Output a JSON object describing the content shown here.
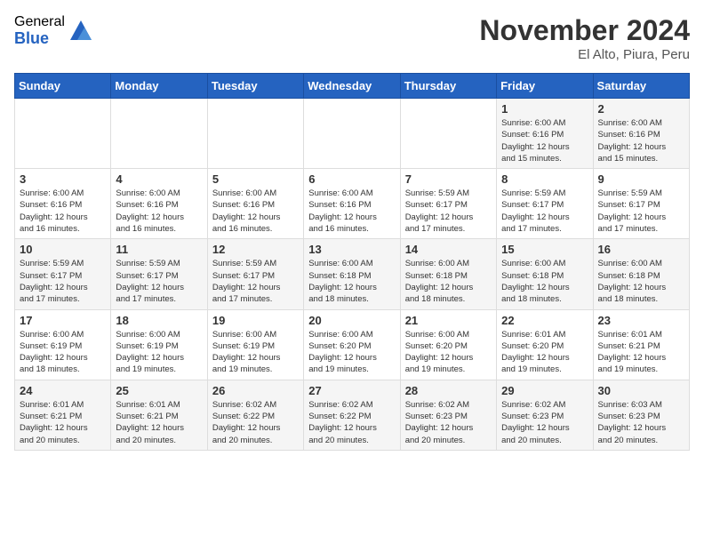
{
  "header": {
    "logo_general": "General",
    "logo_blue": "Blue",
    "title": "November 2024",
    "location": "El Alto, Piura, Peru"
  },
  "days_of_week": [
    "Sunday",
    "Monday",
    "Tuesday",
    "Wednesday",
    "Thursday",
    "Friday",
    "Saturday"
  ],
  "weeks": [
    [
      {
        "day": "",
        "info": ""
      },
      {
        "day": "",
        "info": ""
      },
      {
        "day": "",
        "info": ""
      },
      {
        "day": "",
        "info": ""
      },
      {
        "day": "",
        "info": ""
      },
      {
        "day": "1",
        "info": "Sunrise: 6:00 AM\nSunset: 6:16 PM\nDaylight: 12 hours\nand 15 minutes."
      },
      {
        "day": "2",
        "info": "Sunrise: 6:00 AM\nSunset: 6:16 PM\nDaylight: 12 hours\nand 15 minutes."
      }
    ],
    [
      {
        "day": "3",
        "info": "Sunrise: 6:00 AM\nSunset: 6:16 PM\nDaylight: 12 hours\nand 16 minutes."
      },
      {
        "day": "4",
        "info": "Sunrise: 6:00 AM\nSunset: 6:16 PM\nDaylight: 12 hours\nand 16 minutes."
      },
      {
        "day": "5",
        "info": "Sunrise: 6:00 AM\nSunset: 6:16 PM\nDaylight: 12 hours\nand 16 minutes."
      },
      {
        "day": "6",
        "info": "Sunrise: 6:00 AM\nSunset: 6:16 PM\nDaylight: 12 hours\nand 16 minutes."
      },
      {
        "day": "7",
        "info": "Sunrise: 5:59 AM\nSunset: 6:17 PM\nDaylight: 12 hours\nand 17 minutes."
      },
      {
        "day": "8",
        "info": "Sunrise: 5:59 AM\nSunset: 6:17 PM\nDaylight: 12 hours\nand 17 minutes."
      },
      {
        "day": "9",
        "info": "Sunrise: 5:59 AM\nSunset: 6:17 PM\nDaylight: 12 hours\nand 17 minutes."
      }
    ],
    [
      {
        "day": "10",
        "info": "Sunrise: 5:59 AM\nSunset: 6:17 PM\nDaylight: 12 hours\nand 17 minutes."
      },
      {
        "day": "11",
        "info": "Sunrise: 5:59 AM\nSunset: 6:17 PM\nDaylight: 12 hours\nand 17 minutes."
      },
      {
        "day": "12",
        "info": "Sunrise: 5:59 AM\nSunset: 6:17 PM\nDaylight: 12 hours\nand 17 minutes."
      },
      {
        "day": "13",
        "info": "Sunrise: 6:00 AM\nSunset: 6:18 PM\nDaylight: 12 hours\nand 18 minutes."
      },
      {
        "day": "14",
        "info": "Sunrise: 6:00 AM\nSunset: 6:18 PM\nDaylight: 12 hours\nand 18 minutes."
      },
      {
        "day": "15",
        "info": "Sunrise: 6:00 AM\nSunset: 6:18 PM\nDaylight: 12 hours\nand 18 minutes."
      },
      {
        "day": "16",
        "info": "Sunrise: 6:00 AM\nSunset: 6:18 PM\nDaylight: 12 hours\nand 18 minutes."
      }
    ],
    [
      {
        "day": "17",
        "info": "Sunrise: 6:00 AM\nSunset: 6:19 PM\nDaylight: 12 hours\nand 18 minutes."
      },
      {
        "day": "18",
        "info": "Sunrise: 6:00 AM\nSunset: 6:19 PM\nDaylight: 12 hours\nand 19 minutes."
      },
      {
        "day": "19",
        "info": "Sunrise: 6:00 AM\nSunset: 6:19 PM\nDaylight: 12 hours\nand 19 minutes."
      },
      {
        "day": "20",
        "info": "Sunrise: 6:00 AM\nSunset: 6:20 PM\nDaylight: 12 hours\nand 19 minutes."
      },
      {
        "day": "21",
        "info": "Sunrise: 6:00 AM\nSunset: 6:20 PM\nDaylight: 12 hours\nand 19 minutes."
      },
      {
        "day": "22",
        "info": "Sunrise: 6:01 AM\nSunset: 6:20 PM\nDaylight: 12 hours\nand 19 minutes."
      },
      {
        "day": "23",
        "info": "Sunrise: 6:01 AM\nSunset: 6:21 PM\nDaylight: 12 hours\nand 19 minutes."
      }
    ],
    [
      {
        "day": "24",
        "info": "Sunrise: 6:01 AM\nSunset: 6:21 PM\nDaylight: 12 hours\nand 20 minutes."
      },
      {
        "day": "25",
        "info": "Sunrise: 6:01 AM\nSunset: 6:21 PM\nDaylight: 12 hours\nand 20 minutes."
      },
      {
        "day": "26",
        "info": "Sunrise: 6:02 AM\nSunset: 6:22 PM\nDaylight: 12 hours\nand 20 minutes."
      },
      {
        "day": "27",
        "info": "Sunrise: 6:02 AM\nSunset: 6:22 PM\nDaylight: 12 hours\nand 20 minutes."
      },
      {
        "day": "28",
        "info": "Sunrise: 6:02 AM\nSunset: 6:23 PM\nDaylight: 12 hours\nand 20 minutes."
      },
      {
        "day": "29",
        "info": "Sunrise: 6:02 AM\nSunset: 6:23 PM\nDaylight: 12 hours\nand 20 minutes."
      },
      {
        "day": "30",
        "info": "Sunrise: 6:03 AM\nSunset: 6:23 PM\nDaylight: 12 hours\nand 20 minutes."
      }
    ]
  ]
}
